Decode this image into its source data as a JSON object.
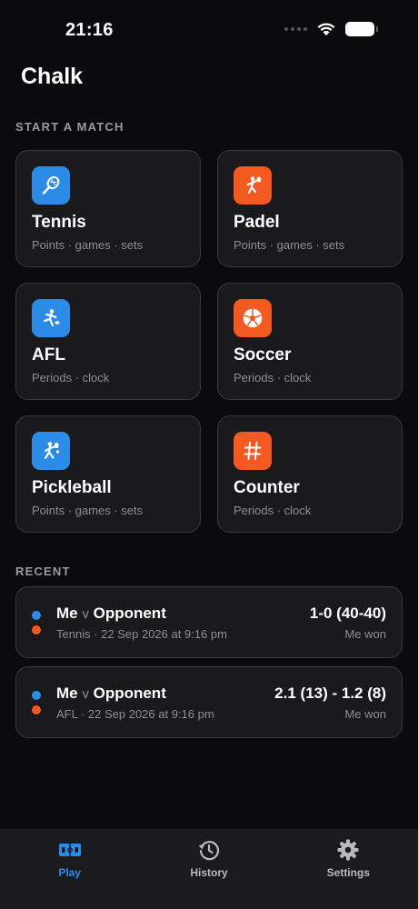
{
  "status": {
    "time": "21:16"
  },
  "app": {
    "title": "Chalk"
  },
  "start_match": {
    "label": "START A MATCH",
    "sports": [
      {
        "name": "Tennis",
        "subtitle": "Points · games · sets",
        "icon": "tennis-racket-icon",
        "color": "#2b8be6"
      },
      {
        "name": "Padel",
        "subtitle": "Points · games · sets",
        "icon": "padel-player-icon",
        "color": "#f25a22"
      },
      {
        "name": "AFL",
        "subtitle": "Periods · clock",
        "icon": "kicking-player-icon",
        "color": "#2b8be6"
      },
      {
        "name": "Soccer",
        "subtitle": "Periods · clock",
        "icon": "soccer-ball-icon",
        "color": "#f25a22"
      },
      {
        "name": "Pickleball",
        "subtitle": "Points · games · sets",
        "icon": "pickleball-player-icon",
        "color": "#2b8be6"
      },
      {
        "name": "Counter",
        "subtitle": "Periods · clock",
        "icon": "hash-icon",
        "color": "#f25a22"
      }
    ]
  },
  "recent": {
    "label": "RECENT",
    "matches": [
      {
        "player1": "Me",
        "versus": "v",
        "player2": "Opponent",
        "meta": "Tennis · 22 Sep 2026 at 9:16 pm",
        "score": "1-0 (40-40)",
        "result": "Me won"
      },
      {
        "player1": "Me",
        "versus": "v",
        "player2": "Opponent",
        "meta": "AFL · 22 Sep 2026 at 9:16 pm",
        "score": "2.1 (13) - 1.2 (8)",
        "result": "Me won"
      }
    ]
  },
  "tabs": [
    {
      "label": "Play",
      "icon": "scoreboard-icon",
      "active": true
    },
    {
      "label": "History",
      "icon": "history-icon",
      "active": false
    },
    {
      "label": "Settings",
      "icon": "gear-icon",
      "active": false
    }
  ],
  "colors": {
    "accent_blue": "#2b8be6",
    "accent_orange": "#f25a22",
    "background": "#0b0b0d",
    "card": "#1a1a1d"
  }
}
